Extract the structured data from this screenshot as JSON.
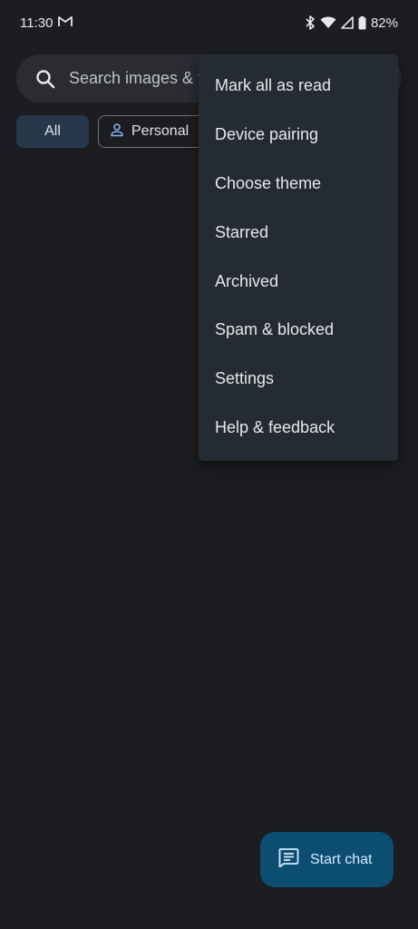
{
  "status_bar": {
    "time": "11:30",
    "battery": "82%",
    "icons": [
      "gmail-icon",
      "bluetooth-icon",
      "wifi-icon",
      "cell-signal-icon",
      "battery-icon"
    ]
  },
  "search": {
    "placeholder": "Search images & v"
  },
  "chips": {
    "all_label": "All",
    "personal_label": "Personal"
  },
  "menu": {
    "items": [
      {
        "label": "Mark all as read"
      },
      {
        "label": "Device pairing"
      },
      {
        "label": "Choose theme"
      },
      {
        "label": "Starred"
      },
      {
        "label": "Archived"
      },
      {
        "label": "Spam & blocked"
      },
      {
        "label": "Settings"
      },
      {
        "label": "Help & feedback"
      }
    ]
  },
  "fab": {
    "label": "Start chat",
    "icon": "message-icon"
  },
  "colors": {
    "background": "#1c1d20",
    "menu_background": "#252b33",
    "fab_background": "#0c4d72",
    "chip_selected": "#27384a",
    "accent_blue": "#8ab4f8"
  }
}
